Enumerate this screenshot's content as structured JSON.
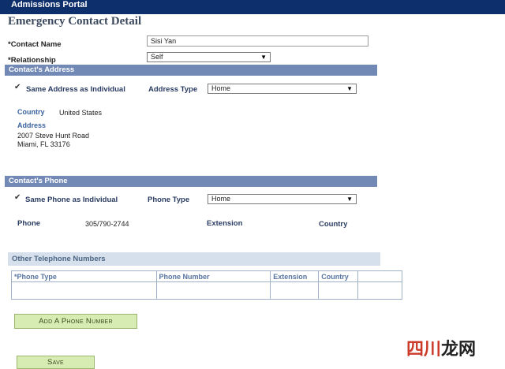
{
  "header": {
    "portal_title": "Admissions Portal"
  },
  "page": {
    "title": "Emergency Contact Detail"
  },
  "contact": {
    "name_label": "*Contact Name",
    "name_value": "Sisi Yan",
    "relationship_label": "*Relationship",
    "relationship_value": "Self"
  },
  "address_section": {
    "title": "Contact's Address",
    "same_as_individual_label": "Same Address as Individual",
    "same_as_individual_checked": true,
    "address_type_label": "Address Type",
    "address_type_value": "Home",
    "country_label": "Country",
    "country_value": "United States",
    "address_label": "Address",
    "address_line1": "2007 Steve Hunt Road",
    "address_line2": "Miami, FL 33176"
  },
  "phone_section": {
    "title": "Contact's Phone",
    "same_as_individual_label": "Same Phone as Individual",
    "same_as_individual_checked": true,
    "phone_type_label": "Phone Type",
    "phone_type_value": "Home",
    "phone_label": "Phone",
    "phone_value": "305/790-2744",
    "extension_label": "Extension",
    "country_label": "Country"
  },
  "other_numbers": {
    "title": "Other Telephone Numbers",
    "columns": [
      "*Phone Type",
      "Phone Number",
      "Extension",
      "Country"
    ],
    "rows": [
      [
        "",
        "",
        "",
        "",
        ""
      ]
    ]
  },
  "buttons": {
    "add_phone": "Add A Phone Number",
    "save": "Save"
  },
  "watermark": {
    "text_red": "四川",
    "text_dark": "龙网"
  },
  "colors": {
    "header_bg": "#0d2f6b",
    "section_bar": "#7289b6",
    "sub_bar": "#d5e0ec",
    "button_bg": "#d7ecb2"
  },
  "icons": {
    "checkbox": "checkmark-icon",
    "dropdown": "chevron-down-icon"
  }
}
